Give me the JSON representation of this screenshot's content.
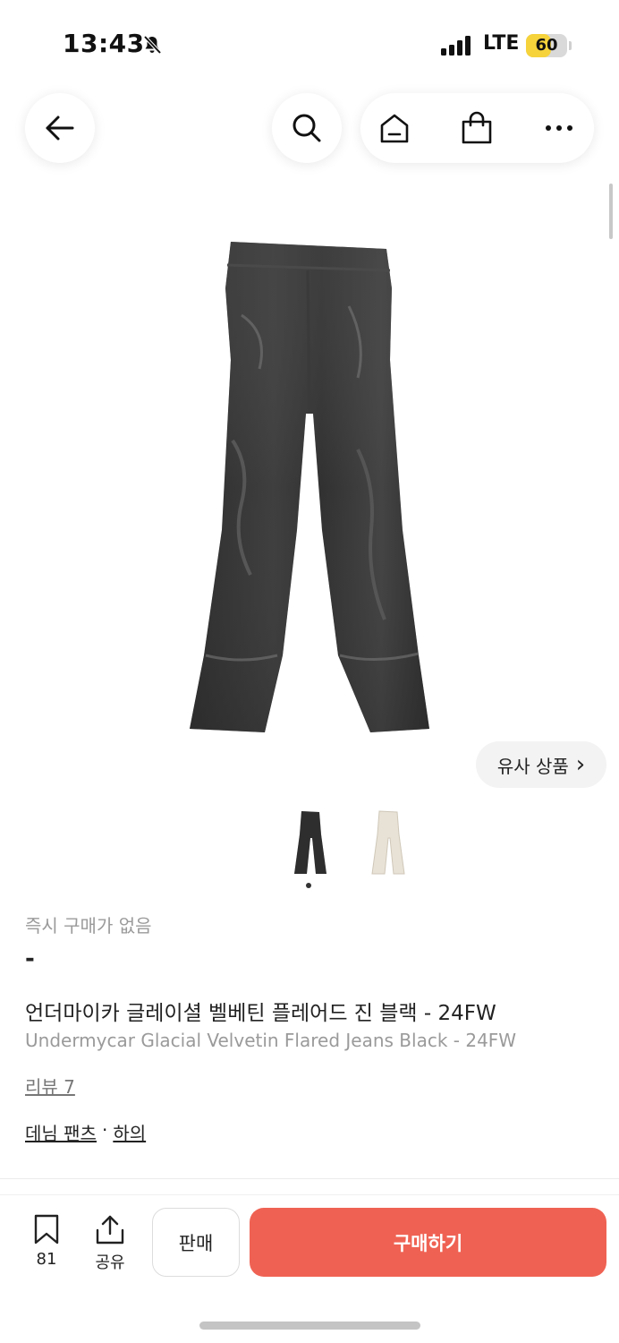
{
  "status_bar": {
    "time": "13:43",
    "network": "LTE",
    "battery": "60",
    "battery_level": 0.6
  },
  "nav": {
    "back_icon": "arrow-left-icon",
    "search_icon": "search-icon",
    "home_icon": "home-icon",
    "cart_icon": "shopping-bag-icon",
    "more_icon": "more-horizontal-icon"
  },
  "product": {
    "similar_label": "유사 상품",
    "similar_chevron": "›",
    "instant_buy_caption": "즉시 구매가 없음",
    "instant_buy_price": "-",
    "title_ko": "언더마이카 글레이셜 벨베틴 플레어드 진 블랙 - 24FW",
    "title_en": "Undermycar Glacial Velvetin Flared Jeans Black - 24FW",
    "review_link": "리뷰 7",
    "category_1": "데님 팬츠",
    "category_sep": "·",
    "category_2": "하의"
  },
  "bottom_bar": {
    "bookmark_count": "81",
    "share_label": "공유",
    "sell_label": "판매",
    "buy_label": "구매하기"
  },
  "colors": {
    "accent": "#ef6253",
    "muted_text": "#9a9a9a",
    "battery": "#f6d33b"
  }
}
